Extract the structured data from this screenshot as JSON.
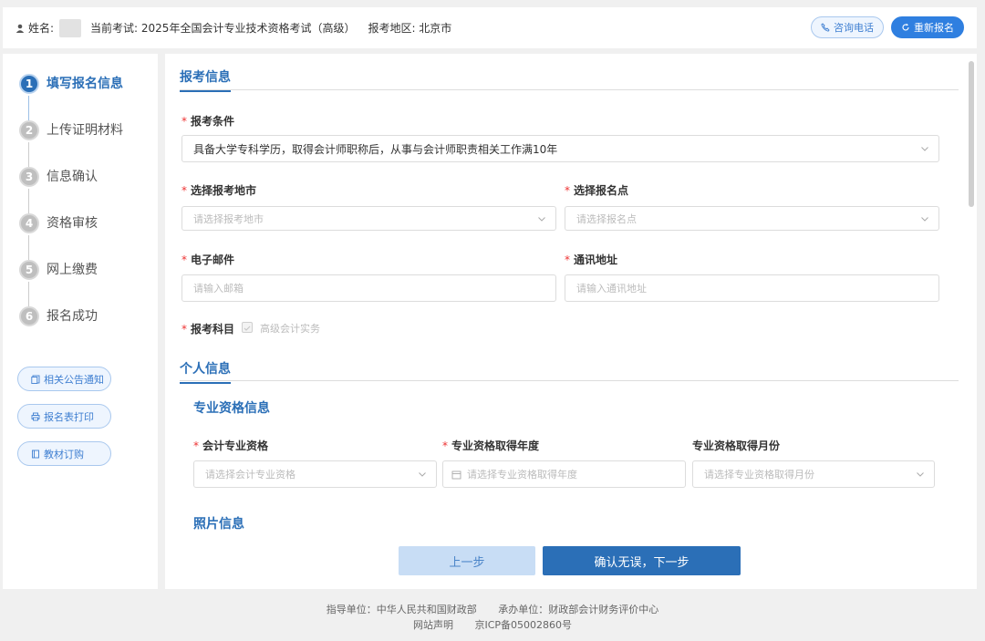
{
  "header": {
    "name_label": "姓名:",
    "exam_label": "当前考试: 2025年全国会计专业技术资格考试（高级）",
    "region_label": "报考地区: 北京市",
    "consult_button": "咨询电话",
    "reapply_button": "重新报名"
  },
  "steps": [
    {
      "num": "1",
      "label": "填写报名信息",
      "active": true
    },
    {
      "num": "2",
      "label": "上传证明材料",
      "active": false
    },
    {
      "num": "3",
      "label": "信息确认",
      "active": false
    },
    {
      "num": "4",
      "label": "资格审核",
      "active": false
    },
    {
      "num": "5",
      "label": "网上缴费",
      "active": false
    },
    {
      "num": "6",
      "label": "报名成功",
      "active": false
    }
  ],
  "side_links": [
    {
      "label": "相关公告通知",
      "icon": "document-icon"
    },
    {
      "label": "报名表打印",
      "icon": "print-icon"
    },
    {
      "label": "教材订购",
      "icon": "book-icon"
    }
  ],
  "form": {
    "section_apply": "报考信息",
    "condition_label": "报考条件",
    "condition_value": "具备大学专科学历，取得会计师职称后，从事与会计师职责相关工作满10年",
    "city_label": "选择报考地市",
    "city_placeholder": "请选择报考地市",
    "site_label": "选择报名点",
    "site_placeholder": "请选择报名点",
    "email_label": "电子邮件",
    "email_placeholder": "请输入邮箱",
    "address_label": "通讯地址",
    "address_placeholder": "请输入通讯地址",
    "subject_label": "报考科目",
    "subject_value": "高级会计实务",
    "section_personal": "个人信息",
    "qual_subtitle": "专业资格信息",
    "qual_label": "会计专业资格",
    "qual_placeholder": "请选择会计专业资格",
    "year_label": "专业资格取得年度",
    "year_placeholder": "请选择专业资格取得年度",
    "month_label": "专业资格取得月份",
    "month_placeholder": "请选择专业资格取得月份",
    "photo_subtitle": "照片信息"
  },
  "actions": {
    "prev": "上一步",
    "next": "确认无误，下一步"
  },
  "footer": {
    "guide": "指导单位：中华人民共和国财政部",
    "host": "承办单位：财政部会计财务评价中心",
    "statement": "网站声明",
    "icp": "京ICP备05002860号"
  }
}
